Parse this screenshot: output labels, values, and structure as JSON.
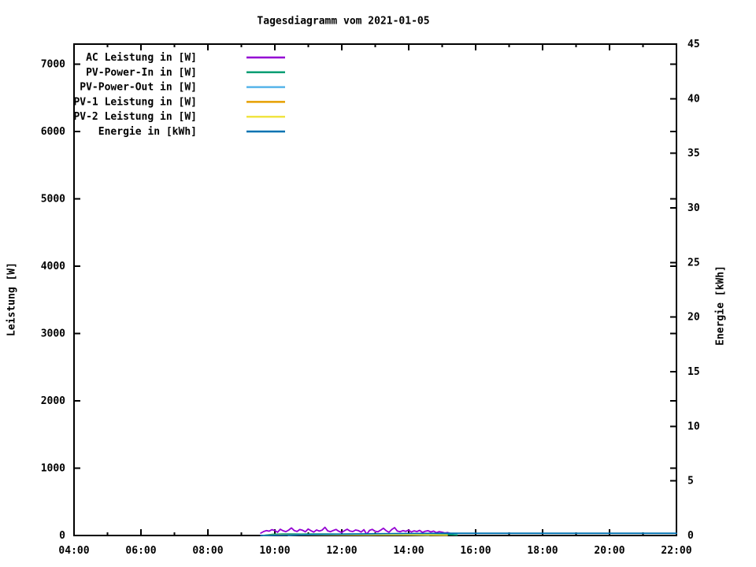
{
  "chart_data": {
    "type": "line",
    "title": "Tagesdiagramm vom 2021-01-05",
    "grid": false,
    "legend_position": "top-left-inside",
    "background_color": "#ffffff",
    "axis_color": "#000000",
    "x_axis": {
      "min_hour": 4,
      "max_hour": 22,
      "major_tick_hours": [
        4,
        6,
        8,
        10,
        12,
        14,
        16,
        18,
        20,
        22
      ],
      "major_tick_labels": [
        "04:00",
        "06:00",
        "08:00",
        "10:00",
        "12:00",
        "14:00",
        "16:00",
        "18:00",
        "20:00",
        "22:00"
      ],
      "minor_tick_hours": [
        5,
        7,
        9,
        11,
        13,
        15,
        17,
        19,
        21
      ]
    },
    "y_axis_left": {
      "label": "Leistung [W]",
      "min": 0,
      "max": 7300,
      "tick_values": [
        0,
        1000,
        2000,
        3000,
        4000,
        5000,
        6000,
        7000
      ],
      "tick_labels": [
        "0",
        "1000",
        "2000",
        "3000",
        "4000",
        "5000",
        "6000",
        "7000"
      ]
    },
    "y_axis_right": {
      "label": "Energie [kWh]",
      "min": 0,
      "max": 45,
      "tick_values": [
        0,
        5,
        10,
        15,
        20,
        25,
        30,
        35,
        40,
        45
      ],
      "tick_labels": [
        "0",
        "5",
        "10",
        "15",
        "20",
        "25",
        "30",
        "35",
        "40",
        "45"
      ]
    },
    "series": [
      {
        "name": "AC Leistung in [W]",
        "color": "#9400d3",
        "axis": "left",
        "x_start": 9.58,
        "x_step": 0.0833,
        "values": [
          35,
          58,
          72,
          64,
          86,
          75,
          48,
          92,
          70,
          57,
          81,
          112,
          74,
          60,
          89,
          77,
          55,
          96,
          71,
          50,
          83,
          66,
          79,
          122,
          69,
          56,
          75,
          90,
          62,
          44,
          71,
          94,
          66,
          58,
          82,
          73,
          50,
          86,
          18,
          76,
          91,
          63,
          55,
          79,
          108,
          70,
          48,
          89,
          117,
          66,
          56,
          73,
          61,
          81,
          52,
          69,
          58,
          76,
          46,
          63,
          71,
          53,
          66,
          42,
          57,
          49,
          38,
          44,
          31,
          26
        ]
      },
      {
        "name": "PV-Power-In in [W]",
        "color": "#009e73",
        "axis": "left",
        "x_start": 9.65,
        "x_step": 0.29,
        "values": [
          0,
          18,
          21,
          22,
          20,
          22,
          21,
          22,
          20,
          21,
          22,
          20,
          22,
          21,
          20,
          22,
          21,
          19,
          22,
          15,
          8
        ]
      },
      {
        "name": "PV-Power-Out in [W]",
        "color": "#56b4e9",
        "axis": "left",
        "x_start": 10.4,
        "x_step": 0.3,
        "values": [
          0,
          9,
          11,
          10,
          11,
          10,
          11,
          10,
          9,
          11,
          10,
          11,
          10,
          8,
          3
        ]
      },
      {
        "name": "PV-1 Leistung in [W]",
        "color": "#e69f00",
        "axis": "left",
        "x_start": 9.65,
        "x_step": 0.5,
        "values": [
          0,
          9,
          11,
          12,
          11,
          12,
          11,
          12,
          11,
          10,
          9,
          6
        ]
      },
      {
        "name": "PV-2 Leistung in [W]",
        "color": "#f0e442",
        "axis": "left",
        "x_start": 9.65,
        "x_step": 0.5,
        "values": [
          0,
          8,
          10,
          11,
          10,
          11,
          11,
          10,
          10,
          9,
          8,
          5
        ]
      },
      {
        "name": "Energie in [kWh]",
        "color": "#0072b2",
        "axis": "right",
        "points": [
          [
            9.58,
            0
          ],
          [
            10,
            0.02
          ],
          [
            10.5,
            0.05
          ],
          [
            11,
            0.08
          ],
          [
            11.5,
            0.1
          ],
          [
            12,
            0.12
          ],
          [
            12.5,
            0.14
          ],
          [
            13,
            0.16
          ],
          [
            13.5,
            0.17
          ],
          [
            14,
            0.18
          ],
          [
            14.5,
            0.19
          ],
          [
            15,
            0.2
          ],
          [
            15.5,
            0.2
          ],
          [
            22,
            0.2
          ]
        ]
      }
    ]
  }
}
